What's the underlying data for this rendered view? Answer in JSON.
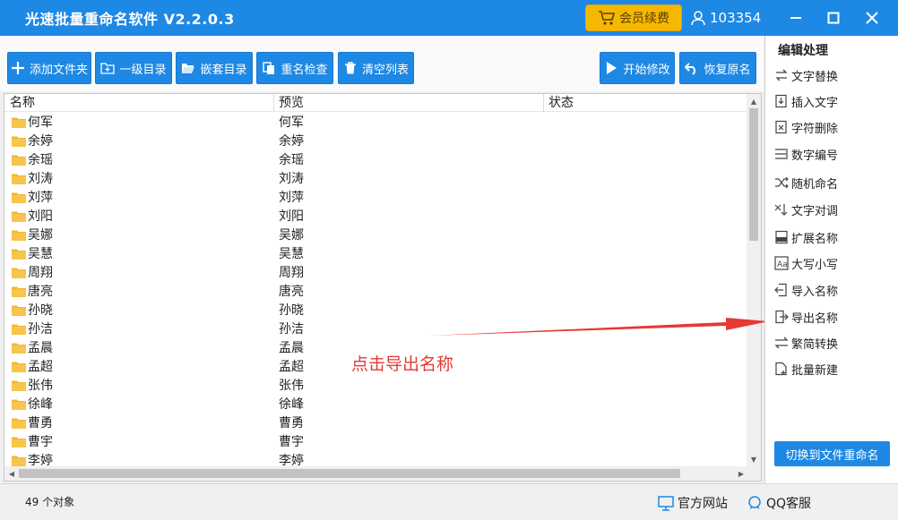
{
  "window": {
    "title": "光速批量重命名软件 V2.2.0.3",
    "vip_label": "会员续费",
    "user_id": "103354"
  },
  "toolbar": {
    "add_folder": "添加文件夹",
    "first_level": "一级目录",
    "nested_dir": "嵌套目录",
    "rename_check": "重名检查",
    "clear_list": "清空列表",
    "start_modify": "开始修改",
    "restore_name": "恢复原名"
  },
  "list": {
    "columns": [
      "名称",
      "预览",
      "状态"
    ],
    "rows": [
      {
        "name": "何军",
        "preview": "何军"
      },
      {
        "name": "余婷",
        "preview": "余婷"
      },
      {
        "name": "余瑶",
        "preview": "余瑶"
      },
      {
        "name": "刘涛",
        "preview": "刘涛"
      },
      {
        "name": "刘萍",
        "preview": "刘萍"
      },
      {
        "name": "刘阳",
        "preview": "刘阳"
      },
      {
        "name": "吴娜",
        "preview": "吴娜"
      },
      {
        "name": "吴慧",
        "preview": "吴慧"
      },
      {
        "name": "周翔",
        "preview": "周翔"
      },
      {
        "name": "唐亮",
        "preview": "唐亮"
      },
      {
        "name": "孙晓",
        "preview": "孙晓"
      },
      {
        "name": "孙洁",
        "preview": "孙洁"
      },
      {
        "name": "孟晨",
        "preview": "孟晨"
      },
      {
        "name": "孟超",
        "preview": "孟超"
      },
      {
        "name": "张伟",
        "preview": "张伟"
      },
      {
        "name": "徐峰",
        "preview": "徐峰"
      },
      {
        "name": "曹勇",
        "preview": "曹勇"
      },
      {
        "name": "曹宇",
        "preview": "曹宇"
      },
      {
        "name": "李婷",
        "preview": "李婷"
      }
    ]
  },
  "annotation": {
    "text": "点击导出名称",
    "color": "#e53935"
  },
  "panel": {
    "title": "编辑处理",
    "items": [
      {
        "label": "文字替换",
        "icon": "replace-icon"
      },
      {
        "label": "插入文字",
        "icon": "insert-text-icon"
      },
      {
        "label": "字符删除",
        "icon": "delete-char-icon"
      },
      {
        "label": "数字编号",
        "icon": "number-list-icon"
      },
      {
        "label": "随机命名",
        "icon": "shuffle-icon"
      },
      {
        "label": "文字对调",
        "icon": "swap-icon"
      },
      {
        "label": "扩展名称",
        "icon": "extension-icon"
      },
      {
        "label": "大写小写",
        "icon": "case-icon"
      },
      {
        "label": "导入名称",
        "icon": "import-icon"
      },
      {
        "label": "导出名称",
        "icon": "export-icon"
      },
      {
        "label": "繁简转换",
        "icon": "convert-icon"
      },
      {
        "label": "批量新建",
        "icon": "new-file-icon"
      }
    ],
    "switch_label": "切换到文件重命名"
  },
  "status": {
    "count": "49 个对象",
    "website": "官方网站",
    "qq": "QQ客服"
  },
  "colors": {
    "accent": "#1e88e5",
    "vip": "#f5b800",
    "folder": "#f2b731"
  }
}
